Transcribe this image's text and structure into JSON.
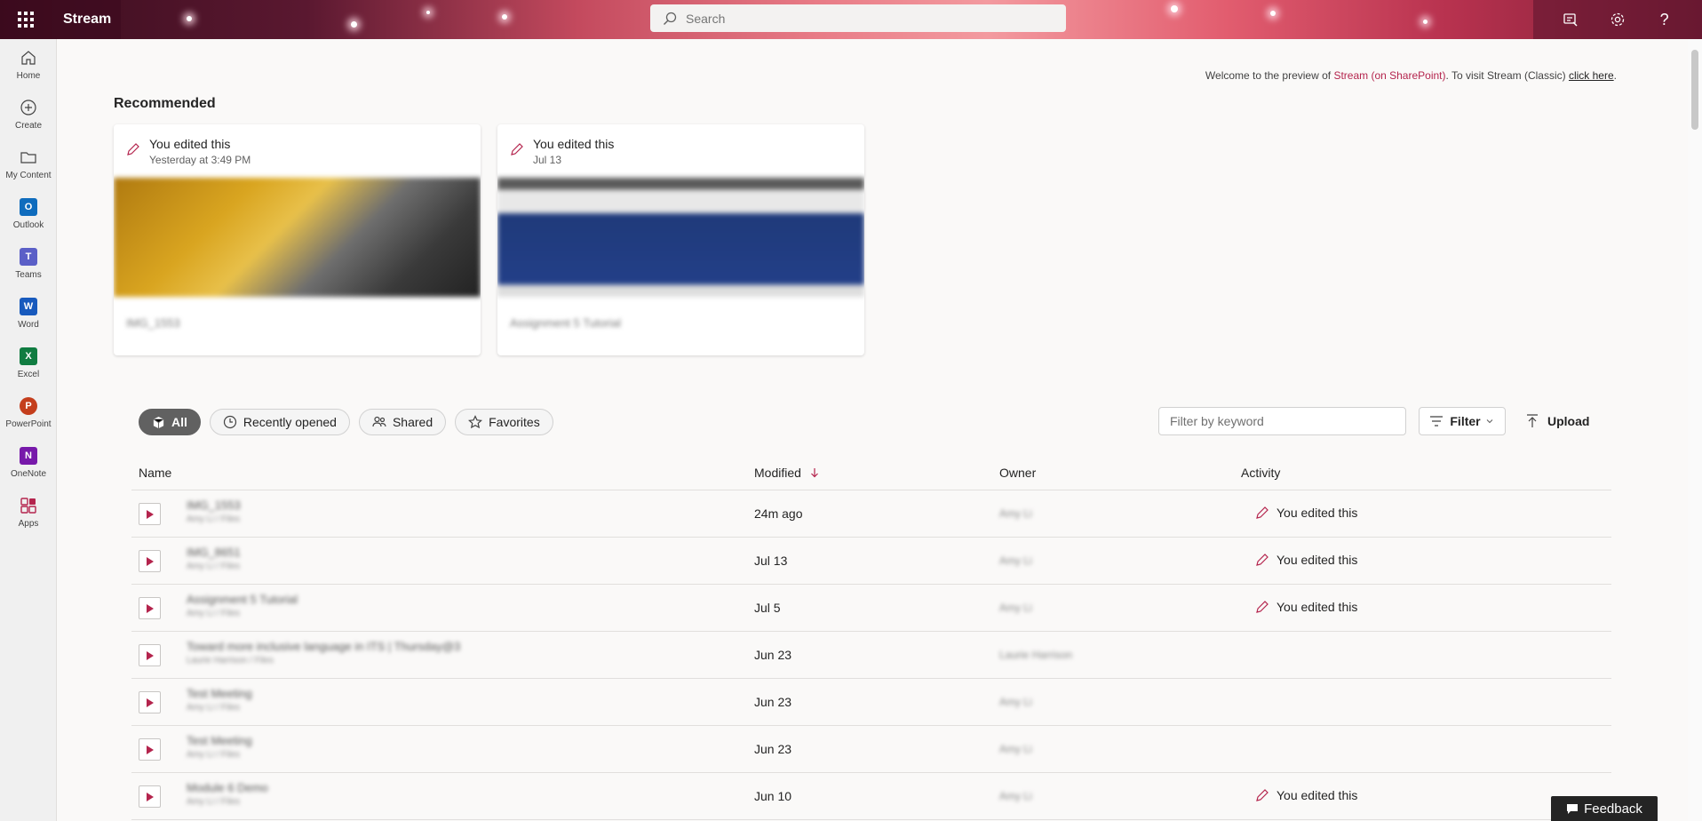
{
  "topbar": {
    "app_title": "Stream",
    "search_placeholder": "Search"
  },
  "rail": {
    "items": [
      {
        "label": "Home",
        "icon": "home-icon"
      },
      {
        "label": "Create",
        "icon": "create-icon"
      },
      {
        "label": "My Content",
        "icon": "folder-icon"
      },
      {
        "label": "Outlook",
        "icon": "outlook-icon",
        "color": "#0f6cbd"
      },
      {
        "label": "Teams",
        "icon": "teams-icon",
        "color": "#5b5fc7"
      },
      {
        "label": "Word",
        "icon": "word-icon",
        "color": "#185abd"
      },
      {
        "label": "Excel",
        "icon": "excel-icon",
        "color": "#107c41"
      },
      {
        "label": "PowerPoint",
        "icon": "powerpoint-icon",
        "color": "#c43e1c"
      },
      {
        "label": "OneNote",
        "icon": "onenote-icon",
        "color": "#7719aa"
      },
      {
        "label": "Apps",
        "icon": "apps-icon",
        "color": "#b4244d"
      }
    ]
  },
  "welcome": {
    "prefix": "Welcome to the preview of ",
    "link": "Stream (on SharePoint)",
    "middle": ". To visit Stream (Classic) ",
    "click": "click here",
    "suffix": "."
  },
  "recommended": {
    "title": "Recommended",
    "cards": [
      {
        "activity": "You edited this",
        "time": "Yesterday at 3:49 PM",
        "name": "IMG_1553"
      },
      {
        "activity": "You edited this",
        "time": "Jul 13",
        "name": "Assignment 5 Tutorial"
      }
    ]
  },
  "pills": [
    {
      "label": "All",
      "icon": "cube-icon",
      "active": true
    },
    {
      "label": "Recently opened",
      "icon": "clock-icon"
    },
    {
      "label": "Shared",
      "icon": "people-icon"
    },
    {
      "label": "Favorites",
      "icon": "star-icon"
    }
  ],
  "toolbar": {
    "filter_placeholder": "Filter by keyword",
    "filter_label": "Filter",
    "upload_label": "Upload"
  },
  "table": {
    "columns": {
      "name": "Name",
      "modified": "Modified",
      "owner": "Owner",
      "activity": "Activity"
    },
    "rows": [
      {
        "name": "IMG_1553",
        "sub": "Amy Li / Files",
        "modified": "24m ago",
        "owner": "Amy Li",
        "activity": "You edited this"
      },
      {
        "name": "IMG_8651",
        "sub": "Amy Li / Files",
        "modified": "Jul 13",
        "owner": "Amy Li",
        "activity": "You edited this"
      },
      {
        "name": "Assignment 5 Tutorial",
        "sub": "Amy Li / Files",
        "modified": "Jul 5",
        "owner": "Amy Li",
        "activity": "You edited this"
      },
      {
        "name": "Toward more inclusive language in ITS | Thursday@3",
        "sub": "Laurie Harrison / Files",
        "modified": "Jun 23",
        "owner": "Laurie Harrison",
        "activity": ""
      },
      {
        "name": "Test Meeting",
        "sub": "Amy Li / Files",
        "modified": "Jun 23",
        "owner": "Amy Li",
        "activity": ""
      },
      {
        "name": "Test Meeting",
        "sub": "Amy Li / Files",
        "modified": "Jun 23",
        "owner": "Amy Li",
        "activity": ""
      },
      {
        "name": "Module 6 Demo",
        "sub": "Amy Li / Files",
        "modified": "Jun 10",
        "owner": "Amy Li",
        "activity": "You edited this"
      }
    ]
  },
  "feedback": "Feedback",
  "colors": {
    "accent": "#b4244d"
  }
}
